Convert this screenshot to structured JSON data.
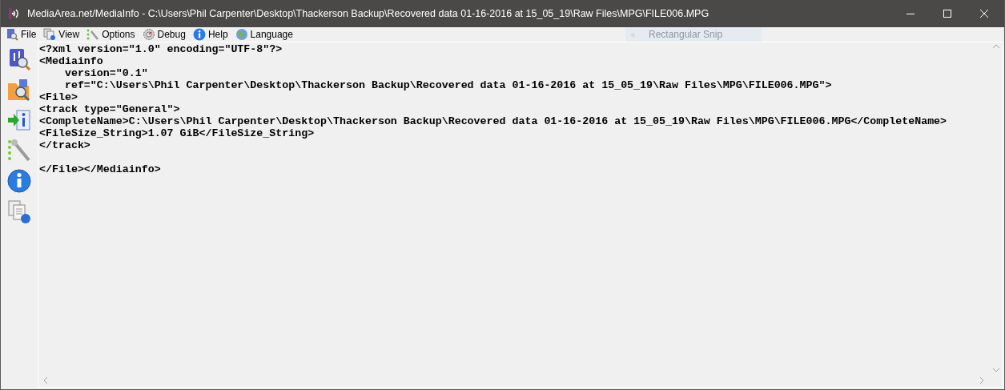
{
  "window": {
    "title": "MediaArea.net/MediaInfo - C:\\Users\\Phil Carpenter\\Desktop\\Thackerson Backup\\Recovered data 01-16-2016 at 15_05_19\\Raw Files\\MPG\\FILE006.MPG"
  },
  "menu": [
    {
      "label": "File",
      "kind": "file"
    },
    {
      "label": "View",
      "kind": "view"
    },
    {
      "label": "Options",
      "kind": "options"
    },
    {
      "label": "Debug",
      "kind": "debug"
    },
    {
      "label": "Help",
      "kind": "help"
    },
    {
      "label": "Language",
      "kind": "language"
    }
  ],
  "overlay": {
    "label": "Rectangular Snip"
  },
  "toolbar": [
    {
      "kind": "open-file"
    },
    {
      "kind": "open-folder"
    },
    {
      "kind": "export"
    },
    {
      "kind": "preferences"
    },
    {
      "kind": "about"
    },
    {
      "kind": "knowledge"
    }
  ],
  "content": {
    "blocks": [
      {
        "lines": [
          "<?xml version=\"1.0\" encoding=\"UTF-8\"?>",
          "<Mediainfo",
          "    version=\"0.1\"",
          "    ref=\"C:\\Users\\Phil Carpenter\\Desktop\\Thackerson Backup\\Recovered data 01-16-2016 at 15_05_19\\Raw Files\\MPG\\FILE006.MPG\">",
          "<File>",
          "<track type=\"General\">",
          "<CompleteName>C:\\Users\\Phil Carpenter\\Desktop\\Thackerson Backup\\Recovered data 01-16-2016 at 15_05_19\\Raw Files\\MPG\\FILE006.MPG</CompleteName>",
          "<FileSize_String>1.07 GiB</FileSize_String>",
          "</track>"
        ]
      },
      {
        "lines": [
          "</File></Mediainfo>"
        ]
      }
    ]
  }
}
